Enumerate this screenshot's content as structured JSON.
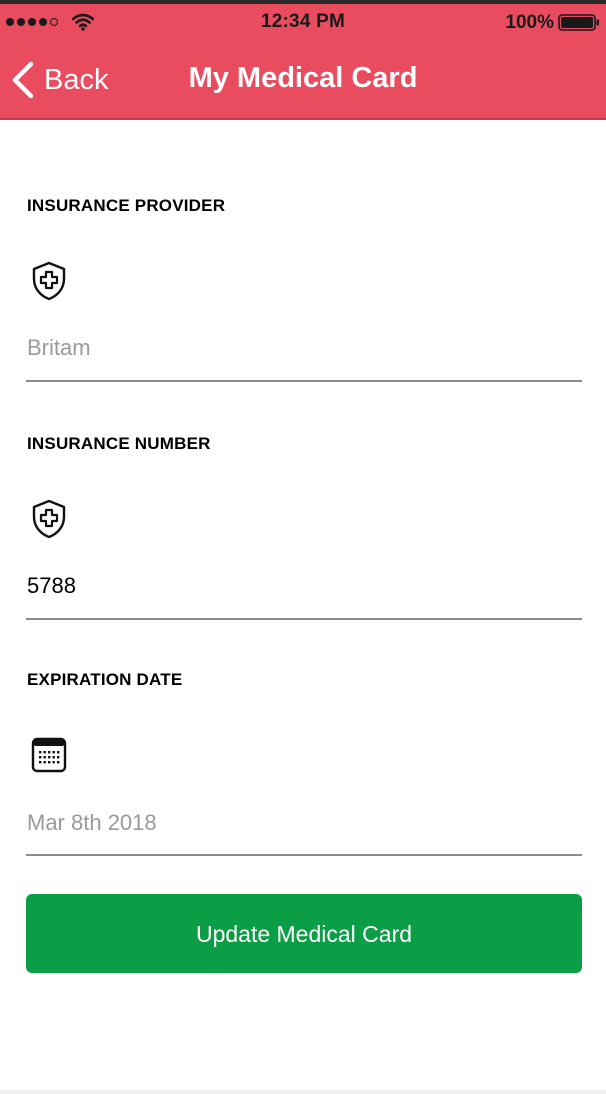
{
  "status_bar": {
    "time": "12:34 PM",
    "battery": "100%",
    "signal_icon": "signal-dots-icon",
    "wifi_icon": "wifi-icon",
    "battery_icon": "battery-icon"
  },
  "nav": {
    "back_label": "Back",
    "title": "My Medical Card",
    "background_color": "#e94b5f"
  },
  "form": {
    "provider": {
      "label": "INSURANCE PROVIDER",
      "icon": "medical-shield-icon",
      "placeholder": "Britam",
      "value": ""
    },
    "number": {
      "label": "INSURANCE NUMBER",
      "icon": "medical-shield-icon",
      "placeholder": "",
      "value": "5788"
    },
    "expiration": {
      "label": "EXPIRATION DATE",
      "icon": "calendar-icon",
      "placeholder": "Mar 8th 2018",
      "value": ""
    }
  },
  "update_button": {
    "label": "Update Medical Card",
    "color": "#0b9e47"
  }
}
